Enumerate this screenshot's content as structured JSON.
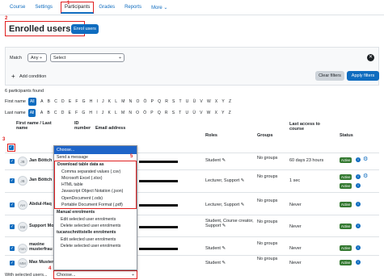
{
  "nav": {
    "items": [
      {
        "label": "Course"
      },
      {
        "label": "Settings"
      },
      {
        "label": "Participants",
        "step": "1"
      },
      {
        "label": "Grades"
      },
      {
        "label": "Reports"
      },
      {
        "label": "More ⌄"
      }
    ]
  },
  "header": {
    "step": "2",
    "title": "Enrolled users ⌄",
    "enrol_button": "Enrol users"
  },
  "filter": {
    "match_label": "Match",
    "match_value": "Any ÷",
    "select_value": "Select",
    "select_arrow": "÷",
    "add_condition": "Add condition",
    "clear_filters": "Clear filters",
    "apply_filters": "Apply filters"
  },
  "participants_found": "6 participants found",
  "first_name_label": "First name",
  "last_name_label": "Last name",
  "all_label": "All",
  "letters": [
    "A",
    "B",
    "C",
    "D",
    "E",
    "F",
    "G",
    "H",
    "I",
    "J",
    "K",
    "L",
    "M",
    "N",
    "O",
    "Ö",
    "P",
    "Q",
    "R",
    "S",
    "T",
    "U",
    "Ü",
    "V",
    "W",
    "X",
    "Y",
    "Z"
  ],
  "table": {
    "col_name": "First name / Last name",
    "col_id": "ID number",
    "col_email": "Email address",
    "col_roles": "Roles",
    "col_groups": "Groups",
    "col_access": "Last access to course",
    "col_status": "Status",
    "step_select_all": "3",
    "rows": [
      {
        "initials": "JB",
        "name": "Jan Böttch",
        "roles": "Student ✎",
        "groups": "No groups",
        "access": "60 days 23 hours",
        "status": "Active"
      },
      {
        "initials": "JB",
        "name": "Jan Böttch",
        "roles": "Lecturer, Support ✎",
        "groups": "No groups",
        "access": "1 sec",
        "status": "Active"
      },
      {
        "initials": "AH",
        "name": "Abdul-Haq",
        "roles": "Lecturer, Support ✎",
        "groups": "No groups",
        "access": "Never",
        "status": "Active"
      },
      {
        "initials": "SM",
        "name": "Support Mo",
        "roles": "Student, Course creator, Support ✎",
        "groups": "No groups",
        "access": "Never",
        "status": "Active"
      },
      {
        "initials": "mm",
        "name": "maxine musterfrau",
        "roles": "Student ✎",
        "groups": "No groups",
        "access": "Never",
        "status": "Active"
      },
      {
        "initials": "MM",
        "name": "Max Muster",
        "roles": "Student ✎",
        "groups": "No groups",
        "access": "Never",
        "status": "Active"
      }
    ]
  },
  "dropdown": {
    "selected": "Choose...",
    "send_message": "Send a message",
    "group_download": "Download table data as",
    "step_download": "5",
    "download_items": [
      "Comma separated values (.csv)",
      "Microsoft Excel (.xlsx)",
      "HTML table",
      "Javascript Object Notation (.json)",
      "OpenDocument (.ods)",
      "Portable Document Format (.pdf)"
    ],
    "group_manual": "Manual enrolments",
    "manual_items": [
      "Edit selected user enrolments",
      "Delete selected user enrolments"
    ],
    "group_tuca": "tucanschnittstelle enrolments",
    "tuca_items": [
      "Edit selected user enrolments",
      "Delete selected user enrolments"
    ]
  },
  "bulk": {
    "label": "With selected users...",
    "step": "4",
    "value": "Choose...",
    "arrow": "÷"
  }
}
